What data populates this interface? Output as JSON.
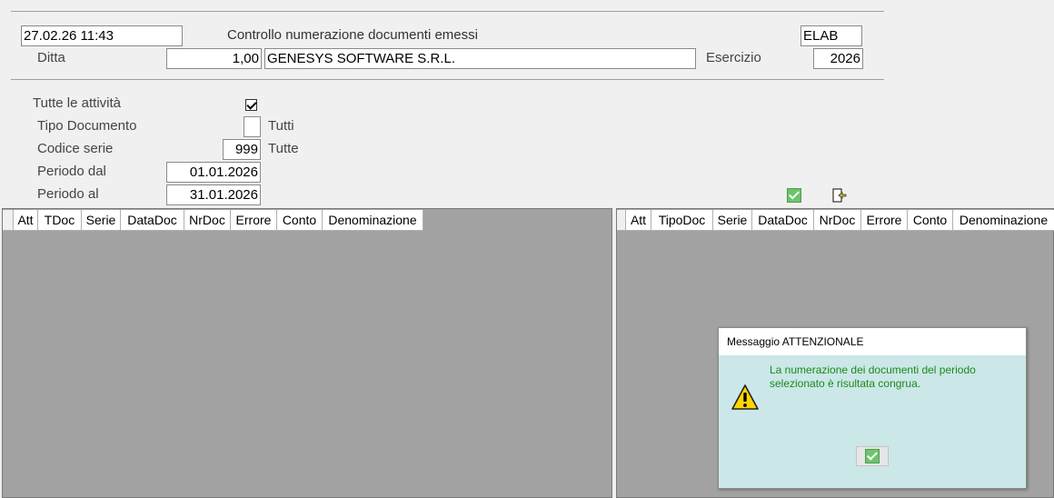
{
  "header": {
    "datetime": "27.02.26 11:43",
    "title": "Controllo numerazione documenti emessi",
    "mode": "ELAB",
    "ditta_label": "Ditta",
    "ditta_code": "1,00",
    "ditta_name": "GENESYS SOFTWARE S.R.L.",
    "esercizio_label": "Esercizio",
    "esercizio_value": "2026"
  },
  "filters": {
    "tutte_attivita_label": "Tutte le attività",
    "tutte_attivita_checked": true,
    "tipo_documento_label": "Tipo Documento",
    "tipo_documento_value": "",
    "tipo_documento_desc": "Tutti",
    "codice_serie_label": "Codice serie",
    "codice_serie_value": "999",
    "codice_serie_desc": "Tutte",
    "periodo_dal_label": "Periodo dal",
    "periodo_dal_value": "01.01.2026",
    "periodo_al_label": "Periodo al",
    "periodo_al_value": "31.01.2026"
  },
  "toolbar": {
    "confirm_icon": "green-check-icon",
    "exit_icon": "exit-door-icon"
  },
  "left_grid": {
    "columns": [
      "Att",
      "TDoc",
      "Serie",
      "DataDoc",
      "NrDoc",
      "Errore",
      "Conto",
      "Denominazione"
    ],
    "rows": []
  },
  "right_grid": {
    "columns": [
      "Att",
      "TipoDoc",
      "Serie",
      "DataDoc",
      "NrDoc",
      "Errore",
      "Conto",
      "Denominazione"
    ],
    "rows": []
  },
  "dialog": {
    "title": "Messaggio ATTENZIONALE",
    "message": "La numerazione dei documenti del periodo selezionato è risultata congrua.",
    "icon": "warning-icon",
    "ok_icon": "green-check-icon"
  },
  "colors": {
    "background": "#f0f0f0",
    "grid_background": "#a2a2a2",
    "dialog_background": "#cbe7e7",
    "message_text": "#1b8a1b"
  }
}
